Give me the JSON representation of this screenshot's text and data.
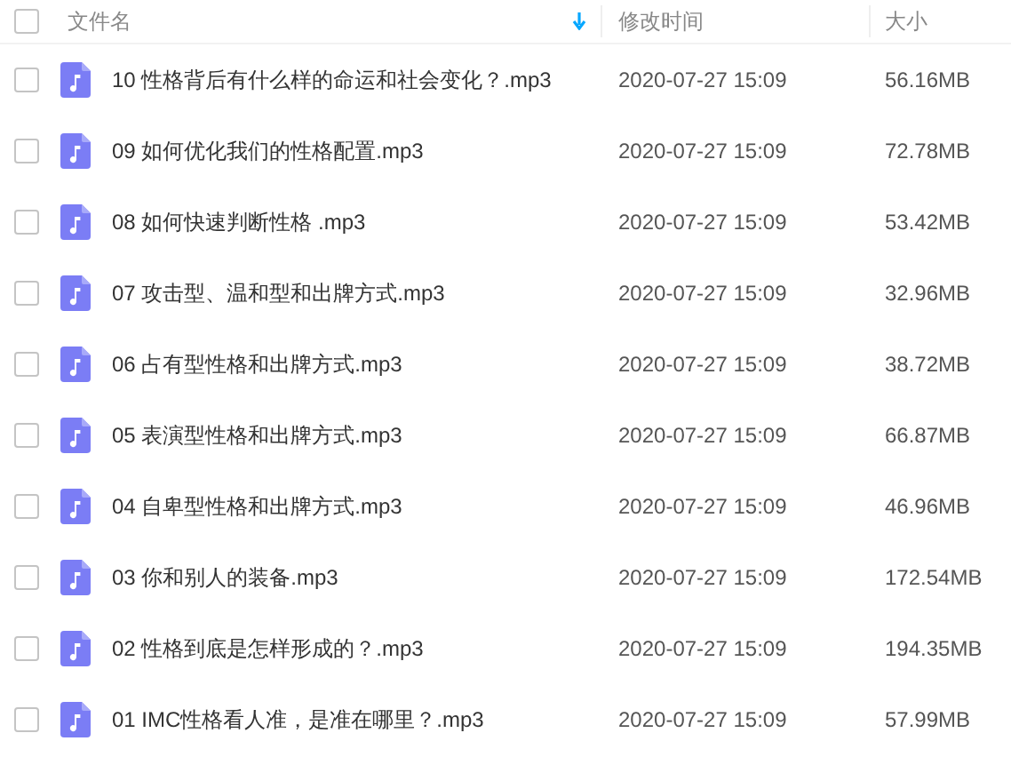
{
  "table": {
    "columns": [
      {
        "label": "文件名",
        "sorted": true
      },
      {
        "label": "修改时间",
        "sorted": false
      },
      {
        "label": "大小",
        "sorted": false
      }
    ],
    "header_checked": false,
    "rows": [
      {
        "name": "10 性格背后有什么样的命运和社会变化？.mp3",
        "modified": "2020-07-27 15:09",
        "size": "56.16MB",
        "checked": false
      },
      {
        "name": "09 如何优化我们的性格配置.mp3",
        "modified": "2020-07-27 15:09",
        "size": "72.78MB",
        "checked": false
      },
      {
        "name": "08 如何快速判断性格 .mp3",
        "modified": "2020-07-27 15:09",
        "size": "53.42MB",
        "checked": false
      },
      {
        "name": "07 攻击型、温和型和出牌方式.mp3",
        "modified": "2020-07-27 15:09",
        "size": "32.96MB",
        "checked": false
      },
      {
        "name": "06 占有型性格和出牌方式.mp3",
        "modified": "2020-07-27 15:09",
        "size": "38.72MB",
        "checked": false
      },
      {
        "name": "05 表演型性格和出牌方式.mp3",
        "modified": "2020-07-27 15:09",
        "size": "66.87MB",
        "checked": false
      },
      {
        "name": "04 自卑型性格和出牌方式.mp3",
        "modified": "2020-07-27 15:09",
        "size": "46.96MB",
        "checked": false
      },
      {
        "name": "03 你和别人的装备.mp3",
        "modified": "2020-07-27 15:09",
        "size": "172.54MB",
        "checked": false
      },
      {
        "name": "02 性格到底是怎样形成的？.mp3",
        "modified": "2020-07-27 15:09",
        "size": "194.35MB",
        "checked": false
      },
      {
        "name": "01 IMC性格看人准，是准在哪里？.mp3",
        "modified": "2020-07-27 15:09",
        "size": "57.99MB",
        "checked": false
      }
    ]
  }
}
